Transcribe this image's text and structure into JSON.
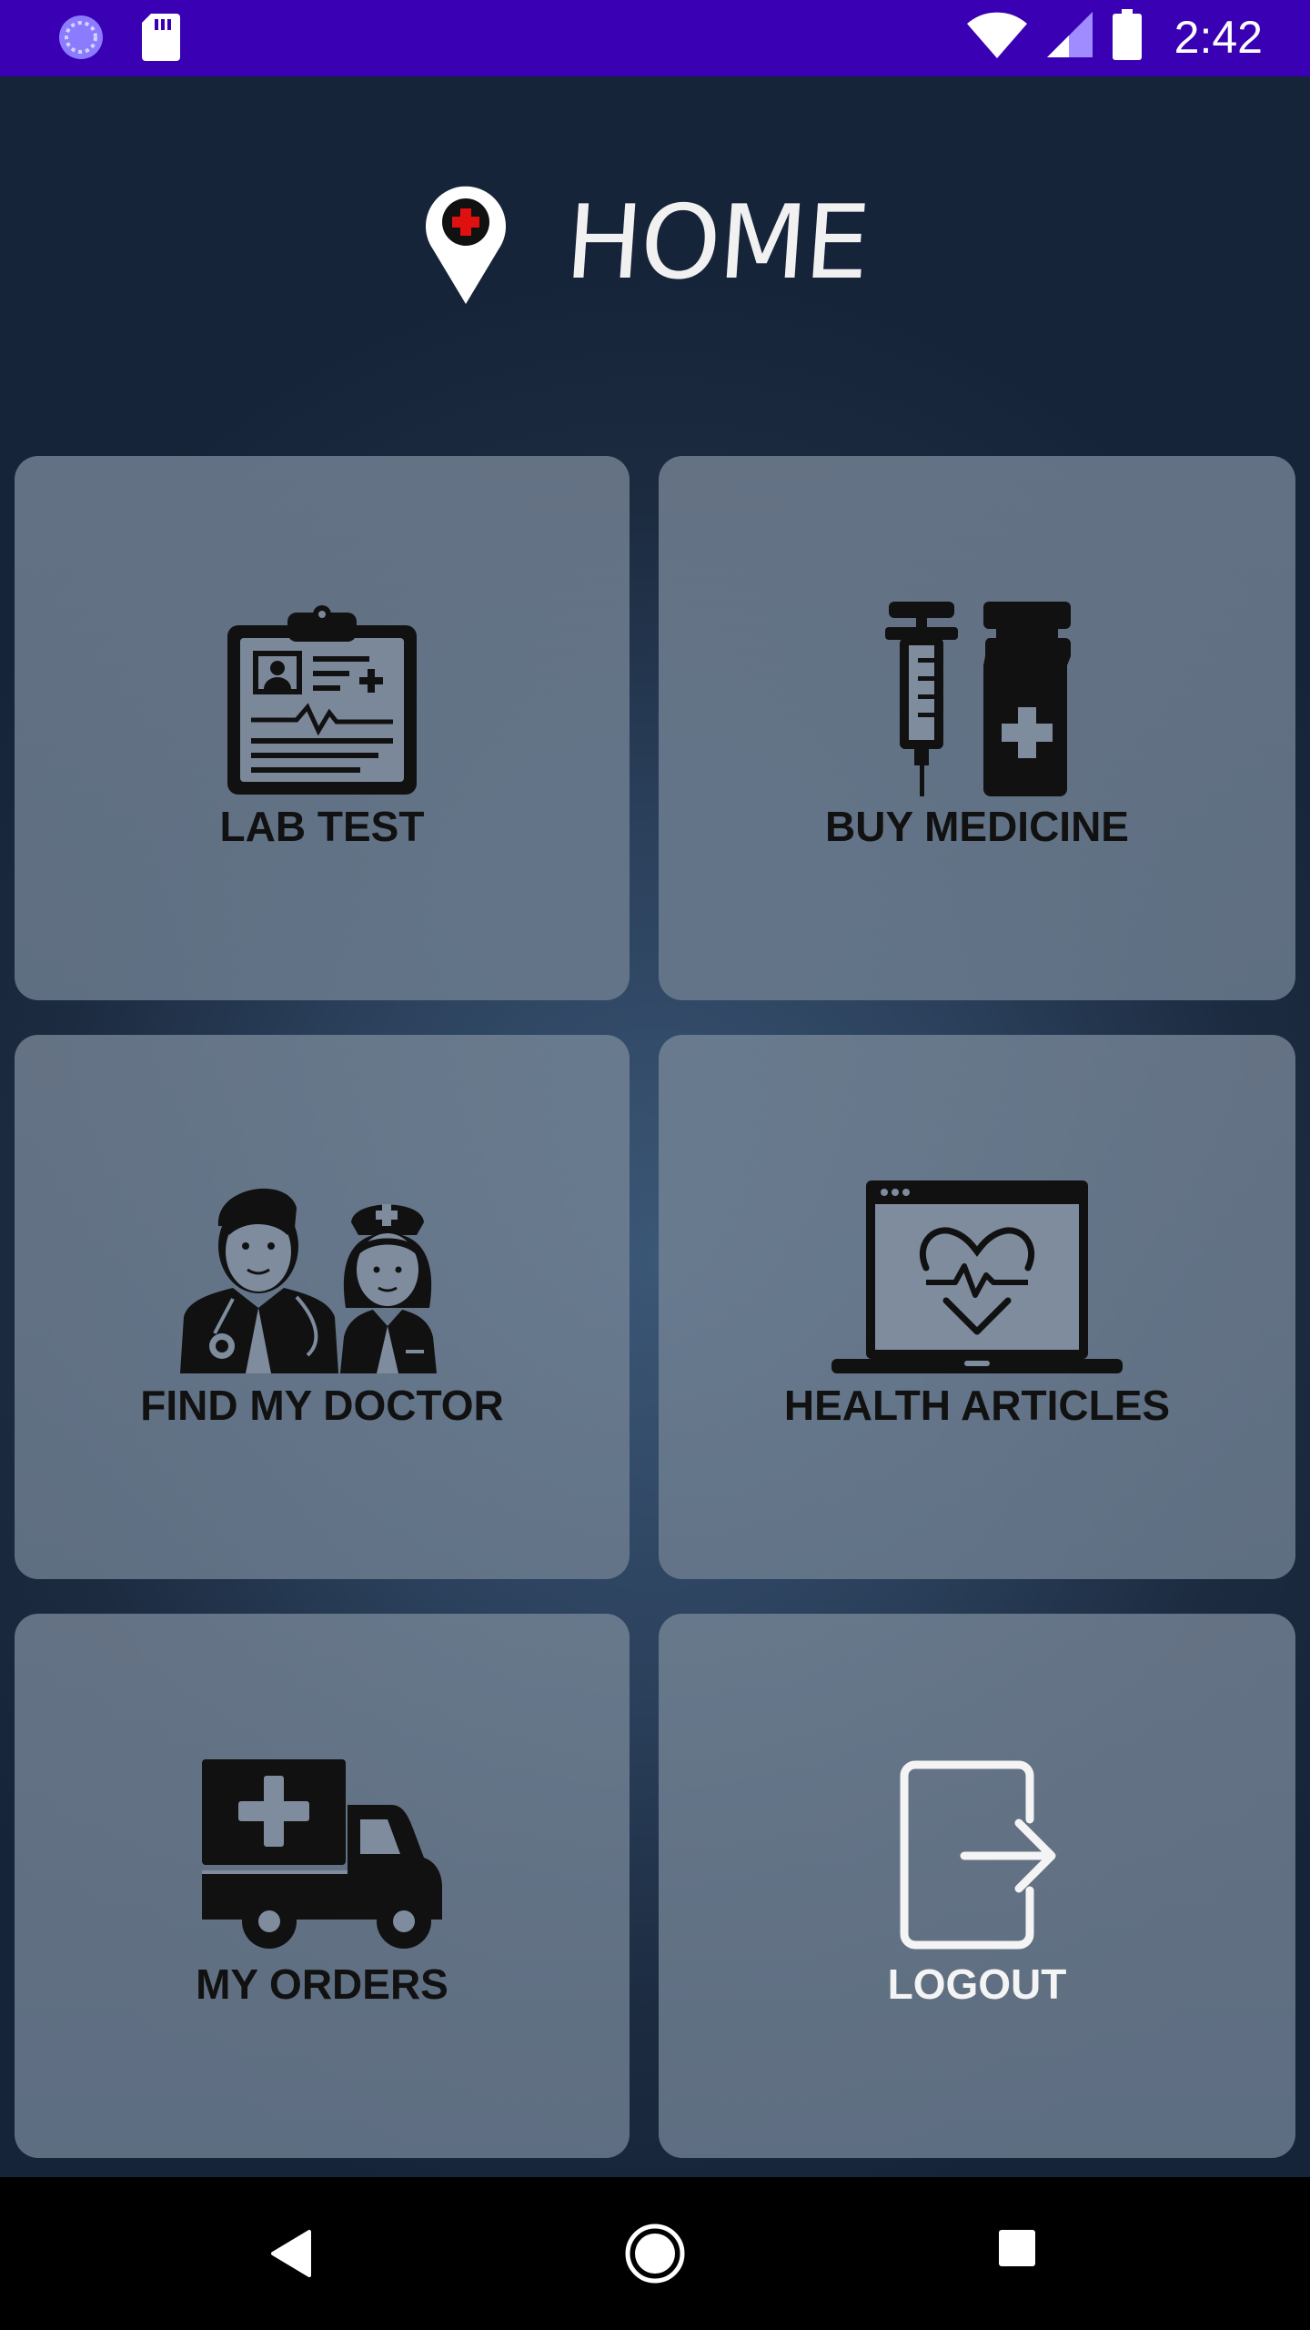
{
  "status_bar": {
    "time": "2:42",
    "icons": [
      "sync-icon",
      "sd-card-icon",
      "wifi-icon",
      "cell-signal-icon",
      "battery-icon"
    ],
    "background": "#3a00b3"
  },
  "header": {
    "title": "HOME",
    "logo_icon": "location-pin-medical-icon"
  },
  "tiles": [
    {
      "label": "LAB TEST",
      "icon": "clipboard-medical-report-icon"
    },
    {
      "label": "BUY MEDICINE",
      "icon": "syringe-bottle-icon"
    },
    {
      "label": "FIND MY DOCTOR",
      "icon": "doctor-nurse-icon"
    },
    {
      "label": "HEALTH ARTICLES",
      "icon": "laptop-heartbeat-icon"
    },
    {
      "label": "MY ORDERS",
      "icon": "delivery-truck-icon"
    },
    {
      "label": "LOGOUT",
      "icon": "logout-icon"
    }
  ],
  "nav_bar": {
    "buttons": [
      "back-icon",
      "home-icon",
      "recents-icon"
    ]
  }
}
